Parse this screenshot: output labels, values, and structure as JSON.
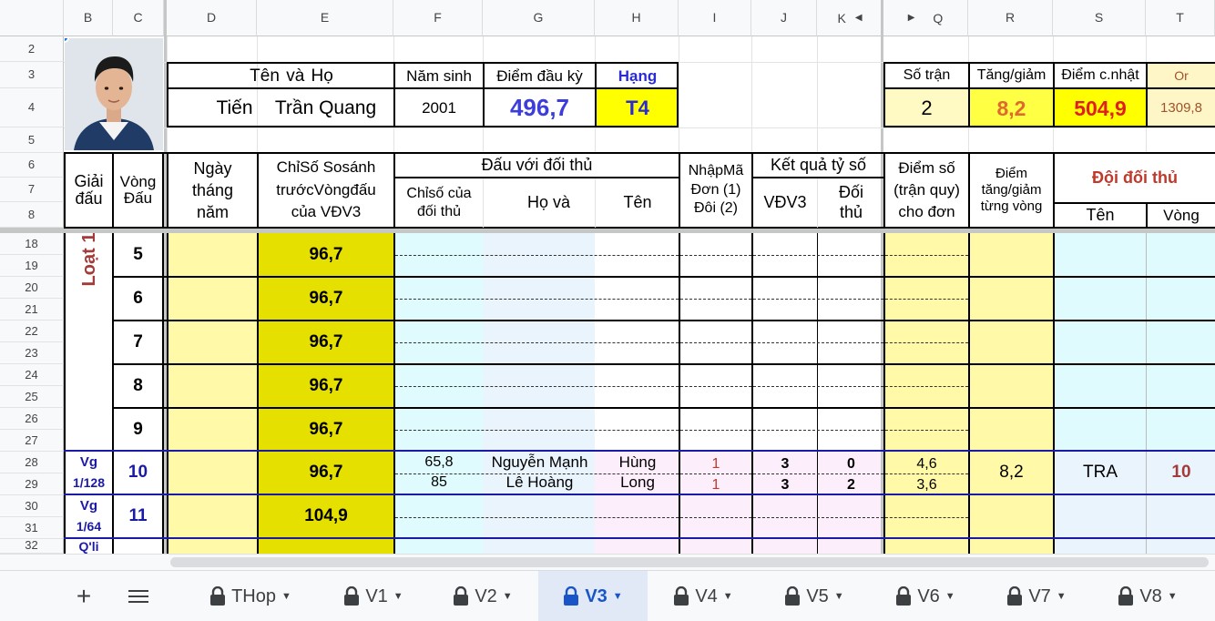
{
  "column_headers": [
    "B",
    "C",
    "D",
    "E",
    "F",
    "G",
    "H",
    "I",
    "J",
    "K",
    "Q",
    "R",
    "S",
    "T"
  ],
  "row_headers": [
    "2",
    "3",
    "4",
    "5",
    "6",
    "7",
    "8",
    "18",
    "19",
    "20",
    "21",
    "22",
    "23",
    "24",
    "25",
    "26",
    "27",
    "28",
    "29",
    "30",
    "31",
    "32"
  ],
  "header": {
    "ten_va_ho_label": "Tên    và    Họ",
    "ten": "Tiến",
    "ho": "Trần Quang",
    "nam_sinh_label": "Năm sinh",
    "nam_sinh": "2001",
    "diem_dau_ky_label": "Điểm đầu kỳ",
    "diem_dau_ky": "496,7",
    "hang_label": "Hạng",
    "hang": "T4",
    "so_tran_label": "Số trận",
    "so_tran": "2",
    "tang_giam_label": "Tăng/giảm",
    "tang_giam": "8,2",
    "diem_cnhat_label": "Điểm c.nhật",
    "diem_cnhat": "504,9",
    "or_label": "Or",
    "or_value": "1309,8"
  },
  "table_header": {
    "giai_dau": "Giải đấu",
    "vong_dau": "Vòng Đấu",
    "ngay": "Ngày tháng năm",
    "chiso": "ChỉSố Sosánh trướcVòngđấu của VĐV3",
    "dau_voi": "Đấu với đối thủ",
    "chiso_doithu": "Chỉsố của đối thủ",
    "ho_va": "Họ      và",
    "ten": "Tên",
    "nhap_ma": "NhậpMã Đơn (1) Đôi (2)",
    "ket_qua": "Kết quả tỷ số",
    "vdv3": "VĐV3",
    "doi_thu": "Đối thủ",
    "diem_so": "Điểm số (trận quy) cho đơn",
    "diem_tang": "Điểm tăng/giảm từng vòng",
    "doi_doi_thu": "Đội đối thủ",
    "doi_ten": "Tên",
    "doi_vong": "Vòng"
  },
  "loat_label": "Loạt 1",
  "rounds": [
    {
      "vong": "5",
      "chiso": "96,7"
    },
    {
      "vong": "6",
      "chiso": "96,7"
    },
    {
      "vong": "7",
      "chiso": "96,7"
    },
    {
      "vong": "8",
      "chiso": "96,7"
    },
    {
      "vong": "9",
      "chiso": "96,7"
    }
  ],
  "round10": {
    "vg_top": "Vg",
    "vg_bottom": "1/128",
    "vong": "10",
    "chiso": "96,7",
    "opp1_chiso": "65,8",
    "opp2_chiso": "85",
    "opp1_ho": "Nguyễn Mạnh",
    "opp1_ten": "Hùng",
    "opp2_ho": "Lê Hoàng",
    "opp2_ten": "Long",
    "ma1": "1",
    "ma2": "1",
    "vdv1": "3",
    "dt1": "0",
    "vdv2": "3",
    "dt2": "2",
    "diem1": "4,6",
    "diem2": "3,6",
    "tang": "8,2",
    "doi_ten": "TRA",
    "doi_vong": "10"
  },
  "round11": {
    "vg_top": "Vg",
    "vg_bottom": "1/64",
    "vong": "11",
    "chiso": "104,9"
  },
  "round12_label": "Q'li",
  "tabs": [
    {
      "label": "THop"
    },
    {
      "label": "V1"
    },
    {
      "label": "V2"
    },
    {
      "label": "V3"
    },
    {
      "label": "V4"
    },
    {
      "label": "V5"
    },
    {
      "label": "V6"
    },
    {
      "label": "V7"
    },
    {
      "label": "V8"
    }
  ],
  "colors": {
    "yellow": "#ffff00",
    "light_yellow": "#fff9a8",
    "olive_yellow": "#e6e000",
    "light_cyan": "#e0fbfd",
    "light_pink": "#fdeefb",
    "navy": "#1a1aa6",
    "maroon": "#a33b3b",
    "accent_blue": "#1a55c8"
  }
}
